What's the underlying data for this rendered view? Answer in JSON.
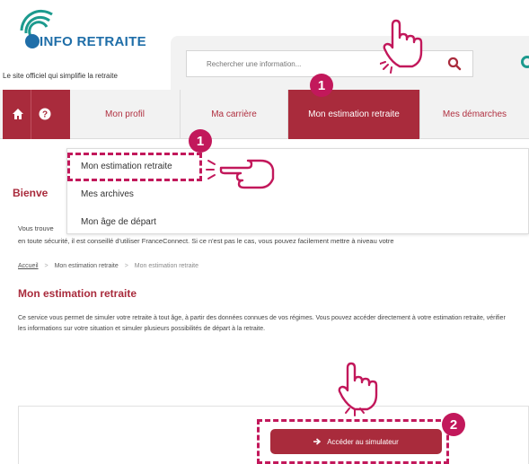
{
  "header": {
    "logo_text": "INFO RETRAITE",
    "tagline": "Le site officiel qui simplifie la retraite",
    "search_placeholder": "Rechercher une information..."
  },
  "nav": {
    "items": [
      {
        "label": "Mon profil"
      },
      {
        "label": "Ma carrière"
      },
      {
        "label": "Mon estimation retraite"
      },
      {
        "label": "Mes démarches"
      }
    ]
  },
  "dropdown": {
    "items": [
      {
        "label": "Mon estimation retraite"
      },
      {
        "label": "Mes archives"
      },
      {
        "label": "Mon âge de départ"
      }
    ]
  },
  "content": {
    "welcome": "Bienve",
    "para1": "Vous trouve",
    "para2": "en toute sécurité, il est conseillé d'utiliser FranceConnect. Si ce n'est pas le cas, vous pouvez facilement mettre à niveau votre",
    "breadcrumb": [
      "Accueil",
      "Mon estimation retraite",
      "Mon estimation retraite"
    ],
    "section_title": "Mon estimation retraite",
    "description": "Ce service vous permet de simuler votre retraite à tout âge, à partir des données connues de vos régimes. Vous pouvez accéder directement à votre estimation retraite, vérifier les informations sur votre situation et simuler plusieurs possibilités de départ à la retraite.",
    "simulator_button": "Accéder au simulateur"
  },
  "annotations": {
    "badge_1": "1",
    "badge_1b": "1",
    "badge_2": "2"
  },
  "colors": {
    "brand_red": "#a92b3c",
    "annotation_pink": "#c2185b",
    "logo_blue": "#1f6ea8",
    "logo_teal": "#1c9a8e"
  }
}
